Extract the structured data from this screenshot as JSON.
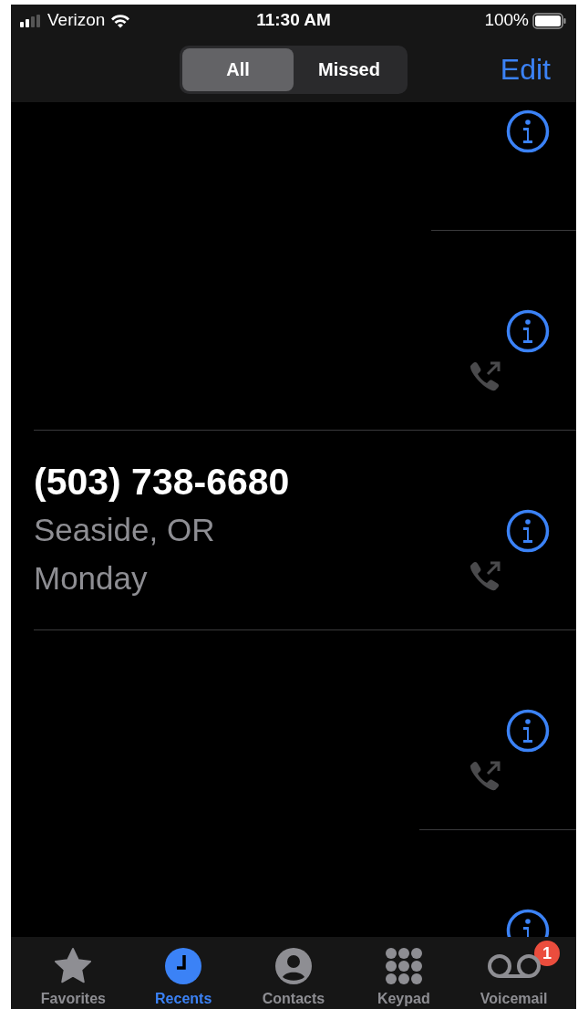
{
  "status_bar": {
    "carrier": "Verizon",
    "time": "11:30 AM",
    "battery": "100%"
  },
  "segments": [
    {
      "label": "All",
      "selected": true
    },
    {
      "label": "Missed",
      "selected": false
    }
  ],
  "edit_button": "Edit",
  "calls": [
    {
      "outgoing": false
    },
    {
      "outgoing": true
    },
    {
      "outgoing": true,
      "number": "(503) 738-6680",
      "location": "Seaside, OR",
      "date": "Monday"
    },
    {
      "outgoing": true
    },
    {
      "outgoing": false
    }
  ],
  "tab_bar": [
    {
      "kind": "favorites",
      "label": "Favorites",
      "selected": false
    },
    {
      "kind": "recents",
      "label": "Recents",
      "selected": true
    },
    {
      "kind": "contacts",
      "label": "Contacts",
      "selected": false
    },
    {
      "kind": "keypad",
      "label": "Keypad",
      "selected": false
    },
    {
      "kind": "voicemail",
      "label": "Voicemail",
      "selected": false,
      "badge": "1"
    }
  ]
}
